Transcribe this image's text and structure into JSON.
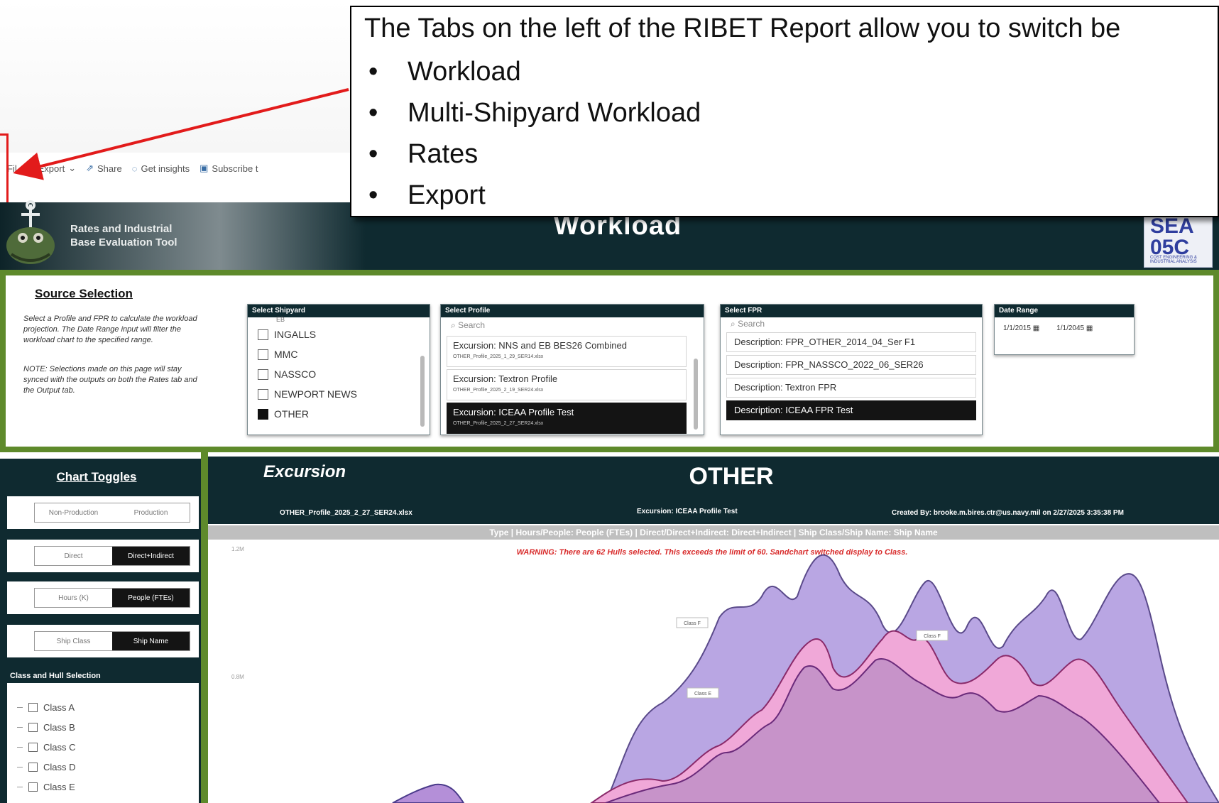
{
  "callout": {
    "text": "The Tabs on the left of the RIBET Report allow you to switch be",
    "items": [
      "Workload",
      "Multi-Shipyard Workload",
      "Rates",
      "Export"
    ],
    "bullet": "•"
  },
  "menubar": {
    "file": "Fil",
    "export": "Export",
    "share": "Share",
    "insights": "Get insights",
    "subscribe": "Subscribe t"
  },
  "banner": {
    "brand_line1": "Rates and Industrial",
    "brand_line2": "Base Evaluation Tool",
    "title": "Workload",
    "logo_text": "SEA 05C",
    "logo_sub": "COST ENGINEERING & INDUSTRIAL ANALYSIS"
  },
  "source": {
    "title": "Source Selection",
    "description": "Select a Profile and FPR to calculate the workload projection. The Date Range input will filter the workload chart to the specified range.",
    "note": "NOTE: Selections made on this page will stay synced with the outputs on both the Rates tab and the Output tab.",
    "shipyard": {
      "header": "Select Shipyard",
      "partial": "EB",
      "items": [
        {
          "label": "INGALLS",
          "checked": false
        },
        {
          "label": "MMC",
          "checked": false
        },
        {
          "label": "NASSCO",
          "checked": false
        },
        {
          "label": "NEWPORT NEWS",
          "checked": false
        },
        {
          "label": "OTHER",
          "checked": true
        }
      ]
    },
    "profile": {
      "header": "Select Profile",
      "search": "Search",
      "options": [
        {
          "label": "Excursion: NNS and EB BES26 Combined",
          "file": "OTHER_Profile_2025_1_29_SER14.xlsx",
          "selected": false
        },
        {
          "label": "Excursion: Textron Profile",
          "file": "OTHER_Profile_2025_2_19_SER24.xlsx",
          "selected": false
        },
        {
          "label": "Excursion: ICEAA Profile Test",
          "file": "OTHER_Profile_2025_2_27_SER24.xlsx",
          "selected": true
        }
      ]
    },
    "fpr": {
      "header": "Select FPR",
      "search": "Search",
      "options": [
        {
          "label": "Description: FPR_OTHER_2014_04_Ser F1",
          "selected": false
        },
        {
          "label": "Description: FPR_NASSCO_2022_06_SER26",
          "selected": false
        },
        {
          "label": "Description: Textron FPR",
          "selected": false
        },
        {
          "label": "Description: ICEAA FPR Test",
          "selected": true
        }
      ]
    },
    "date_range": {
      "header": "Date Range",
      "start": "1/1/2015",
      "end": "1/1/2045",
      "calendar_icon": "▦"
    }
  },
  "toggles": {
    "title": "Chart Toggles",
    "groups": [
      {
        "left": "Non-Production",
        "right": "Production",
        "active": "none"
      },
      {
        "left": "Direct",
        "right": "Direct+Indirect",
        "active": "right"
      },
      {
        "left": "Hours (K)",
        "right": "People (FTEs)",
        "active": "right"
      },
      {
        "left": "Ship Class",
        "right": "Ship Name",
        "active": "right"
      }
    ],
    "hull_label": "Class and Hull Selection",
    "hull_items": [
      "Class A",
      "Class B",
      "Class C",
      "Class D",
      "Class E"
    ]
  },
  "chart": {
    "excursion": "Excursion",
    "title": "OTHER",
    "file": "OTHER_Profile_2025_2_27_SER24.xlsx",
    "profile": "Excursion: ICEAA Profile Test",
    "created": "Created By: brooke.m.bires.ctr@us.navy.mil on 2/27/2025 3:35:38 PM",
    "type_line": "Type | Hours/People: People (FTEs) | Direct/Direct+Indirect: Direct+Indirect | Ship Class/Ship Name: Ship Name",
    "warning": "WARNING: There are 62 Hulls selected. This exceeds the limit of 60. Sandchart switched display to Class.",
    "ytick_1": "1.2M",
    "ytick_2": "0.8M",
    "label_f": "Class F",
    "label_e": "Class E",
    "label_g": "Class F"
  },
  "colors": {
    "dark": "#0f2a30",
    "green": "#5e8a2b",
    "arrow": "#e21b1b",
    "purple_light": "#b9a6e3",
    "purple_mid": "#c793c9",
    "pink": "#f0a8d8"
  }
}
